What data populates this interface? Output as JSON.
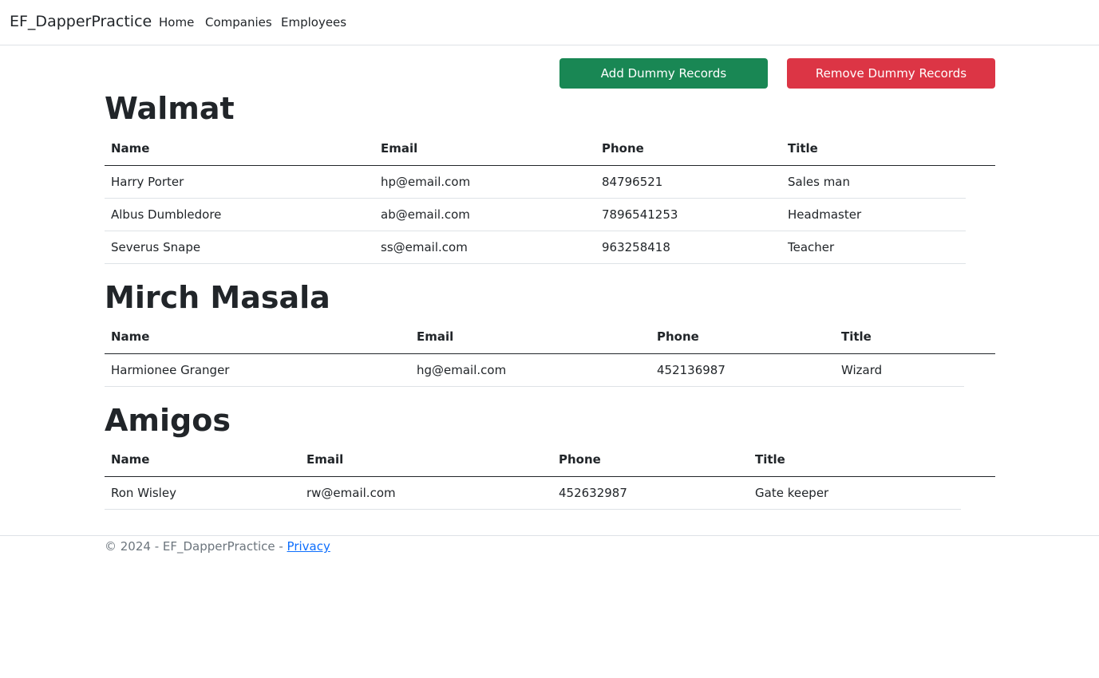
{
  "navbar": {
    "brand": "EF_DapperPractice",
    "links": [
      "Home",
      "Companies",
      "Employees"
    ]
  },
  "actions": {
    "add_label": "Add Dummy Records",
    "remove_label": "Remove Dummy Records"
  },
  "colors": {
    "add_button": "#198754",
    "remove_button": "#dc3545",
    "link": "#0d6efd"
  },
  "companies": [
    {
      "name": "Walmat",
      "headers": [
        "Name",
        "Email",
        "Phone",
        "Title"
      ],
      "rows": [
        [
          "Harry Porter",
          "hp@email.com",
          "84796521",
          "Sales man"
        ],
        [
          "Albus Dumbledore",
          "ab@email.com",
          "7896541253",
          "Headmaster"
        ],
        [
          "Severus Snape",
          "ss@email.com",
          "963258418",
          "Teacher"
        ]
      ]
    },
    {
      "name": "Mirch Masala",
      "headers": [
        "Name",
        "Email",
        "Phone",
        "Title"
      ],
      "rows": [
        [
          "Harmionee Granger",
          "hg@email.com",
          "452136987",
          "Wizard"
        ]
      ]
    },
    {
      "name": "Amigos",
      "headers": [
        "Name",
        "Email",
        "Phone",
        "Title"
      ],
      "rows": [
        [
          "Ron Wisley",
          "rw@email.com",
          "452632987",
          "Gate keeper"
        ]
      ]
    }
  ],
  "footer": {
    "text": "© 2024 - EF_DapperPractice - ",
    "link": "Privacy"
  }
}
